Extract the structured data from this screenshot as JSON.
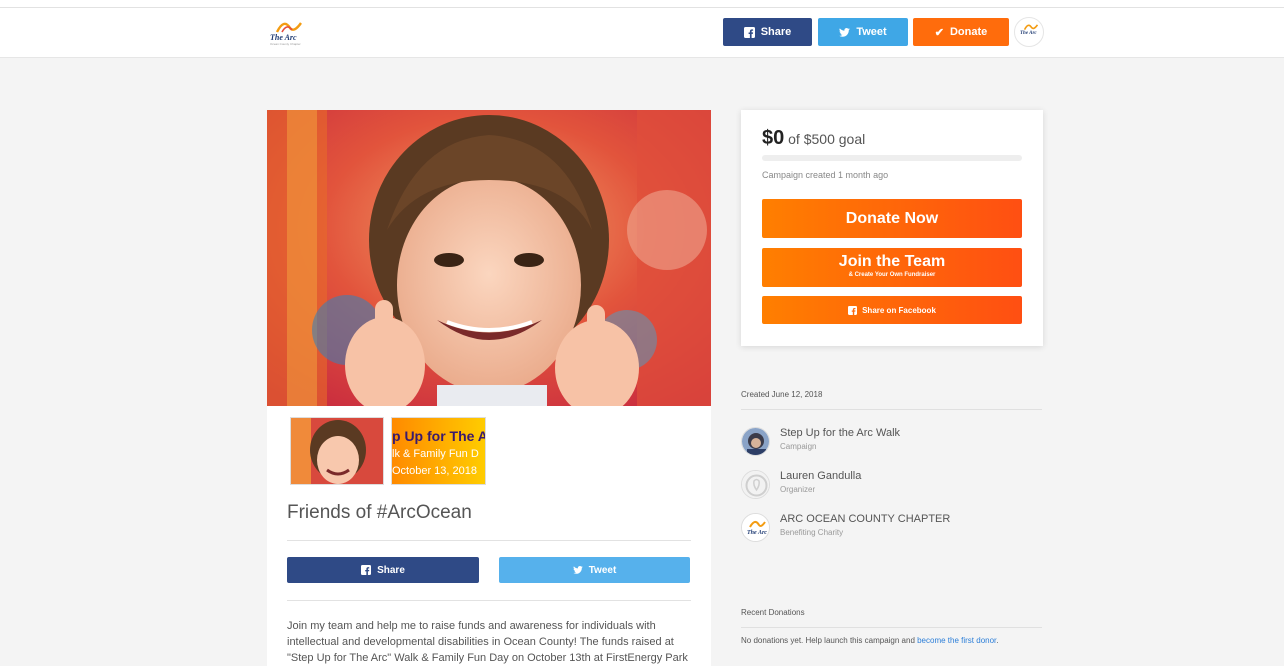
{
  "header": {
    "share_label": "Share",
    "tweet_label": "Tweet",
    "donate_label": "Donate"
  },
  "logo": {
    "name": "The Arc",
    "tagline": "Ocean County Chapter"
  },
  "campaign": {
    "title": "Friends of #ArcOcean",
    "thumb2_line1": "p Up for The A",
    "thumb2_line2": "lk & Family Fun D",
    "thumb2_line3": "October 13, 2018",
    "share_label": "Share",
    "tweet_label": "Tweet",
    "description": "Join my team and help me to raise funds and awareness for individuals with intellectual and developmental disabilities in Ocean County! The funds raised at \"Step Up for The Arc\" Walk & Family Fun Day on October 13th at FirstEnergy Park"
  },
  "goal": {
    "raised": "$0",
    "of_goal": "of $500 goal",
    "progress_fraction": 0,
    "created_ago": "Campaign created 1 month ago"
  },
  "actions": {
    "donate_now": "Donate Now",
    "join_team": "Join the Team",
    "join_team_sub": "& Create Your Own Fundraiser",
    "share_facebook": "Share on Facebook"
  },
  "meta": {
    "created": "Created June 12, 2018",
    "people": [
      {
        "name": "Step Up for the Arc Walk",
        "role": "Campaign"
      },
      {
        "name": "Lauren Gandulla",
        "role": "Organizer"
      },
      {
        "name": "ARC OCEAN COUNTY CHAPTER",
        "role": "Benefiting Charity"
      }
    ],
    "recent_donations_label": "Recent Donations",
    "no_donations_text": "No donations yet. Help launch this campaign and ",
    "no_donations_link": "become the first donor",
    "no_donations_end": "."
  },
  "colors": {
    "facebook": "#2f4a86",
    "twitter": "#3fa7e6",
    "orange": "#ff6c0c"
  }
}
